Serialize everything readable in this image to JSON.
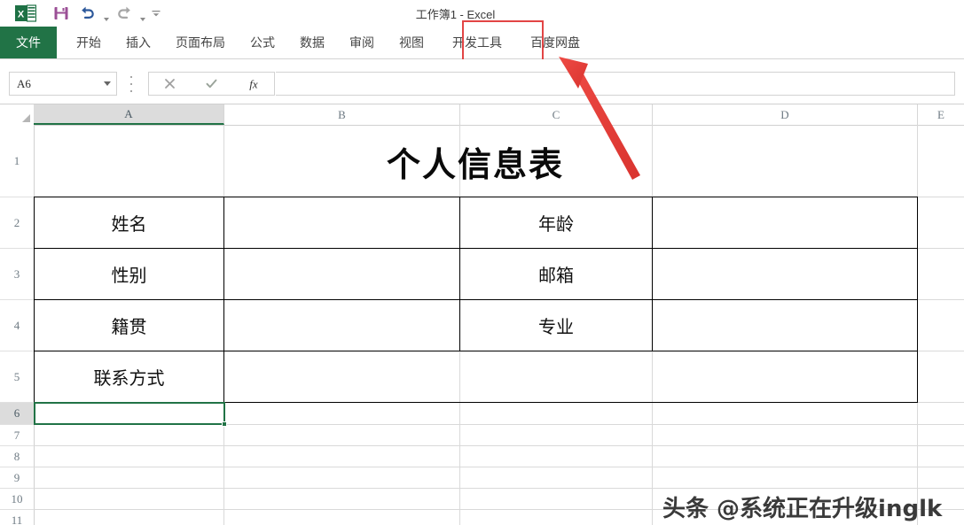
{
  "window": {
    "title": "工作簿1 - Excel"
  },
  "quick_access": {
    "app_icon": "excel-logo-icon",
    "buttons": [
      {
        "name": "save-button",
        "icon": "save-floppy-icon"
      },
      {
        "name": "undo-button",
        "icon": "undo-arrow-icon"
      },
      {
        "name": "redo-button",
        "icon": "redo-arrow-icon"
      },
      {
        "name": "customize-quick-access-button",
        "icon": "overflow-caret-icon"
      }
    ]
  },
  "ribbon": {
    "tabs": [
      {
        "label": "文件",
        "name": "tab-file",
        "active": false,
        "style": "file"
      },
      {
        "label": "开始",
        "name": "tab-home",
        "active": false
      },
      {
        "label": "插入",
        "name": "tab-insert",
        "active": false
      },
      {
        "label": "页面布局",
        "name": "tab-page-layout",
        "active": false
      },
      {
        "label": "公式",
        "name": "tab-formulas",
        "active": false
      },
      {
        "label": "数据",
        "name": "tab-data",
        "active": false
      },
      {
        "label": "审阅",
        "name": "tab-review",
        "active": false
      },
      {
        "label": "视图",
        "name": "tab-view",
        "active": false
      },
      {
        "label": "开发工具",
        "name": "tab-developer",
        "highlighted": true
      },
      {
        "label": "百度网盘",
        "name": "tab-baidu-netdisk",
        "active": false
      }
    ],
    "highlight_color": "#e24545"
  },
  "formula_bar": {
    "name_box_value": "A6",
    "cancel_icon": "cancel-x-icon",
    "confirm_icon": "confirm-check-icon",
    "function_icon": "fx-insert-function-icon",
    "formula_value": ""
  },
  "grid": {
    "columns": [
      {
        "label": "A",
        "selected": true
      },
      {
        "label": "B",
        "selected": false
      },
      {
        "label": "C",
        "selected": false
      },
      {
        "label": "D",
        "selected": false
      },
      {
        "label": "E",
        "selected": false
      }
    ],
    "rows": [
      {
        "label": "1",
        "selected": false
      },
      {
        "label": "2",
        "selected": false
      },
      {
        "label": "3",
        "selected": false
      },
      {
        "label": "4",
        "selected": false
      },
      {
        "label": "5",
        "selected": false
      },
      {
        "label": "6",
        "selected": true
      },
      {
        "label": "7",
        "selected": false
      },
      {
        "label": "8",
        "selected": false
      },
      {
        "label": "9",
        "selected": false
      },
      {
        "label": "10",
        "selected": false
      },
      {
        "label": "11",
        "selected": false
      }
    ],
    "active_cell": "A6",
    "selection_color": "#217346"
  },
  "sheet_table": {
    "title": "个人信息表",
    "labels": {
      "name": "姓名",
      "age": "年龄",
      "gender": "性别",
      "email": "邮箱",
      "hometown": "籍贯",
      "major": "专业",
      "contact": "联系方式"
    },
    "values": {
      "name": "",
      "age": "",
      "gender": "",
      "email": "",
      "hometown": "",
      "major": "",
      "contact": ""
    }
  },
  "watermark": {
    "text": "头条 @系统正在升级inglk"
  },
  "annotation": {
    "arrow_color": "#e8413c",
    "arrow_target": "tab-developer"
  }
}
